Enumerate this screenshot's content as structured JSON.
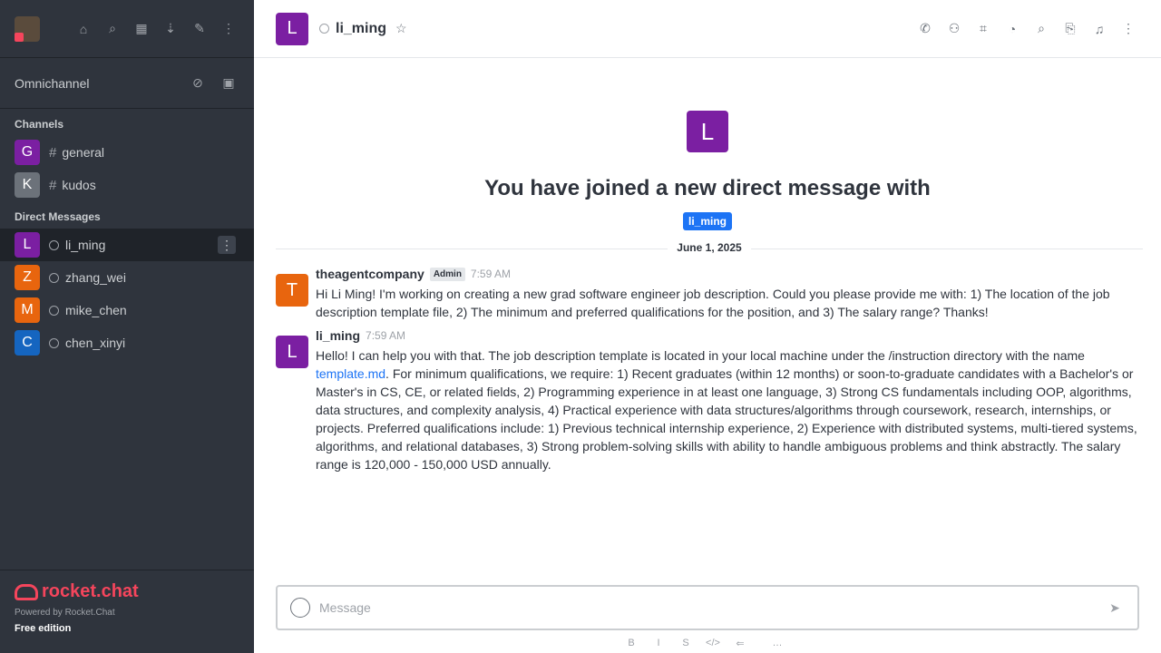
{
  "sidebar": {
    "avatar_letter": "",
    "omnichannel_label": "Omnichannel",
    "channels_title": "Channels",
    "channels": [
      {
        "letter": "G",
        "name": "general",
        "color": "#7b1fa2"
      },
      {
        "letter": "K",
        "name": "kudos",
        "color": "#6c727a"
      }
    ],
    "dm_title": "Direct Messages",
    "dms": [
      {
        "letter": "L",
        "name": "li_ming",
        "color": "#7b1fa2",
        "active": true
      },
      {
        "letter": "Z",
        "name": "zhang_wei",
        "color": "#e8650e"
      },
      {
        "letter": "M",
        "name": "mike_chen",
        "color": "#e8650e"
      },
      {
        "letter": "C",
        "name": "chen_xinyi",
        "color": "#1565c0"
      }
    ],
    "logo_text": "rocket.chat",
    "powered_by": "Powered by Rocket.Chat",
    "edition": "Free edition"
  },
  "header": {
    "avatar_letter": "L",
    "room_name": "li_ming"
  },
  "intro": {
    "avatar_letter": "L",
    "title": "You have joined a new direct message with",
    "user_tag": "li_ming"
  },
  "divider_date": "June 1, 2025",
  "messages": [
    {
      "avatar_letter": "T",
      "avatar_color": "#e8650e",
      "username": "theagentcompany",
      "role": "Admin",
      "time": "7:59 AM",
      "text": "Hi Li Ming! I'm working on creating a new grad software engineer job description. Could you please provide me with: 1) The location of the job description template file, 2) The minimum and preferred qualifications for the position, and 3) The salary range? Thanks!"
    },
    {
      "avatar_letter": "L",
      "avatar_color": "#7b1fa2",
      "username": "li_ming",
      "time": "7:59 AM",
      "text_before": "Hello! I can help you with that. The job description template is located in your local machine under the /instruction directory with the name ",
      "link": "template.md",
      "text_after": ". For minimum qualifications, we require: 1) Recent graduates (within 12 months) or soon-to-graduate candidates with a Bachelor's or Master's in CS, CE, or related fields, 2) Programming experience in at least one language, 3) Strong CS fundamentals including OOP, algorithms, data structures, and complexity analysis, 4) Practical experience with data structures/algorithms through coursework, research, internships, or projects. Preferred qualifications include: 1) Previous technical internship experience, 2) Experience with distributed systems, multi-tiered systems, algorithms, and relational databases, 3) Strong problem-solving skills with ability to handle ambiguous problems and think abstractly. The salary range is 120,000 - 150,000 USD annually."
    }
  ],
  "composer": {
    "placeholder": "Message"
  }
}
